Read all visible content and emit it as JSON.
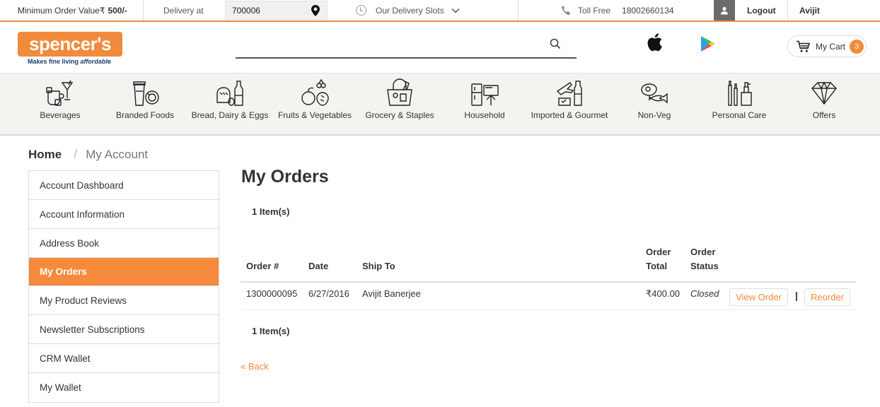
{
  "topbar": {
    "min_order_label": "Minimum Order Value ",
    "min_order_symbol": "₹",
    "min_order_value": "500/-",
    "delivery_label": "Delivery at",
    "pincode": "700006",
    "delivery_slots_label": "Our Delivery Slots",
    "toll_free_label": "Toll Free",
    "toll_free_number": "18002660134",
    "logout_label": "Logout",
    "user_name": "Avijit"
  },
  "header": {
    "logo_text": "spencer's",
    "tagline_plain": "Makes fine living ",
    "tagline_italic": "affordable",
    "search_placeholder": "",
    "cart_label": "My Cart",
    "cart_count": "3"
  },
  "categories": [
    {
      "label": "Beverages",
      "icon": "beverages-icon"
    },
    {
      "label": "Branded Foods",
      "icon": "branded-foods-icon"
    },
    {
      "label": "Bread, Dairy & Eggs",
      "icon": "bread-dairy-icon"
    },
    {
      "label": "Fruits & Vegetables",
      "icon": "fruits-icon"
    },
    {
      "label": "Grocery & Staples",
      "icon": "grocery-icon"
    },
    {
      "label": "Household",
      "icon": "household-icon"
    },
    {
      "label": "Imported & Gourmet",
      "icon": "imported-icon"
    },
    {
      "label": "Non-Veg",
      "icon": "non-veg-icon"
    },
    {
      "label": "Personal Care",
      "icon": "personal-care-icon"
    },
    {
      "label": "Offers",
      "icon": "offers-icon"
    }
  ],
  "breadcrumb": {
    "home": "Home",
    "separator": "/",
    "current": "My Account"
  },
  "sidebar": {
    "items": [
      {
        "label": "Account Dashboard",
        "active": false
      },
      {
        "label": "Account Information",
        "active": false
      },
      {
        "label": "Address Book",
        "active": false
      },
      {
        "label": "My Orders",
        "active": true
      },
      {
        "label": "My Product Reviews",
        "active": false
      },
      {
        "label": "Newsletter Subscriptions",
        "active": false
      },
      {
        "label": "CRM Wallet",
        "active": false
      },
      {
        "label": "My Wallet",
        "active": false
      }
    ]
  },
  "orders": {
    "title": "My Orders",
    "item_count_top": "1 Item(s)",
    "item_count_bottom": "1 Item(s)",
    "columns": {
      "order_no": "Order #",
      "date": "Date",
      "ship_to": "Ship To",
      "total_1": "Order",
      "total_2": "Total",
      "status_1": "Order",
      "status_2": "Status"
    },
    "rows": [
      {
        "order_no": "1300000095",
        "date": "6/27/2016",
        "ship_to": "Avijit Banerjee",
        "total": "₹400.00",
        "status": "Closed",
        "view_label": "View Order",
        "separator": "|",
        "reorder_label": "Reorder"
      }
    ],
    "back_label": "« Back"
  },
  "colors": {
    "accent": "#f58a3c",
    "text": "#333333",
    "category_bg": "#f4f3ef"
  }
}
